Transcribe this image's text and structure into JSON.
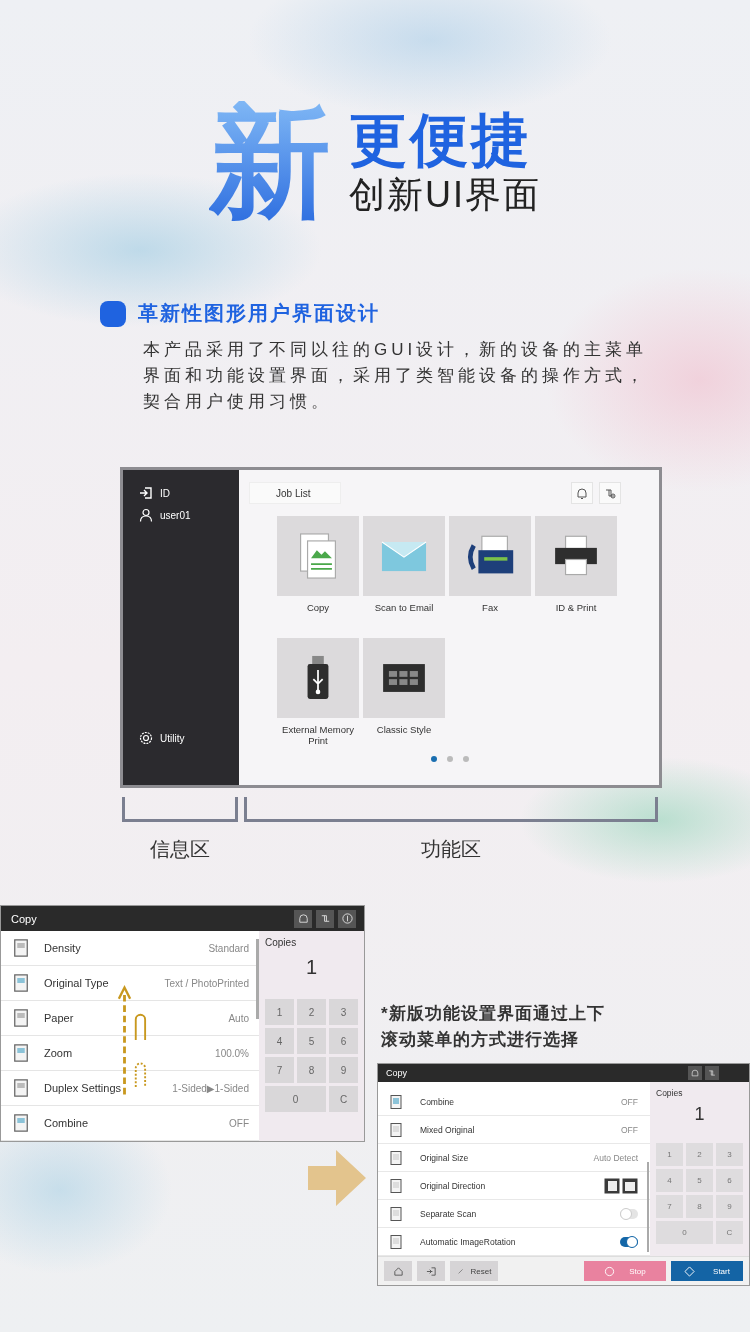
{
  "hero": {
    "big_char": "新",
    "tagline": "更便捷",
    "subtitle": "创新UI界面"
  },
  "section": {
    "title": "革新性图形用户界面设计",
    "body": "本产品采用了不同以往的GUI设计，新的设备的主菜单界面和功能设置界面，采用了类智能设备的操作方式，契合用户使用习惯。"
  },
  "home_screen": {
    "sidebar": {
      "login": "ID",
      "user": "user01",
      "utility": "Utility"
    },
    "job_list": "Job List",
    "apps": [
      {
        "kind": "copy",
        "label": "Copy"
      },
      {
        "kind": "email",
        "label": "Scan to Email"
      },
      {
        "kind": "fax",
        "label": "Fax"
      },
      {
        "kind": "print",
        "label": "ID & Print"
      },
      {
        "kind": "usb",
        "label": "External Memory Print"
      },
      {
        "kind": "grid",
        "label": "Classic Style"
      }
    ],
    "pages": [
      {
        "selected": true
      },
      {
        "selected": false
      },
      {
        "selected": false
      }
    ]
  },
  "zones": [
    {
      "label": "信息区"
    },
    {
      "label": "功能区"
    }
  ],
  "copy_screen_old": {
    "title": "Copy",
    "settings": [
      {
        "label": "Density",
        "value": "Standard"
      },
      {
        "label": "Original Type",
        "value": "Text / PhotoPrinted"
      },
      {
        "label": "Paper",
        "value": "Auto"
      },
      {
        "label": "Zoom",
        "value": "100.0%"
      },
      {
        "label": "Duplex Settings",
        "value": "1-Sided▶1-Sided"
      },
      {
        "label": "Combine",
        "value": "OFF"
      }
    ],
    "copies_label": "Copies",
    "copies": "1",
    "keypad": [
      "1",
      "2",
      "3",
      "4",
      "5",
      "6",
      "7",
      "8",
      "9",
      "0",
      "C"
    ]
  },
  "note": "*新版功能设置界面通过上下滚动菜单的方式进行选择",
  "copy_screen_new": {
    "title": "Copy",
    "settings": [
      {
        "kind": "text",
        "label": "Combine",
        "value": "OFF"
      },
      {
        "kind": "text",
        "label": "Mixed Original",
        "value": "OFF"
      },
      {
        "kind": "text",
        "label": "Original Size",
        "value": "Auto Detect"
      },
      {
        "kind": "direction",
        "label": "Original Direction"
      },
      {
        "kind": "toggle",
        "label": "Separate Scan",
        "on": false
      },
      {
        "kind": "toggle",
        "label": "Automatic ImageRotation",
        "on": true
      }
    ],
    "copies_label": "Copies",
    "copies": "1",
    "keypad": [
      "1",
      "2",
      "3",
      "4",
      "5",
      "6",
      "7",
      "8",
      "9",
      "0",
      "C"
    ],
    "footer": {
      "reset": "Reset",
      "stop": "Stop",
      "start": "Start"
    }
  }
}
